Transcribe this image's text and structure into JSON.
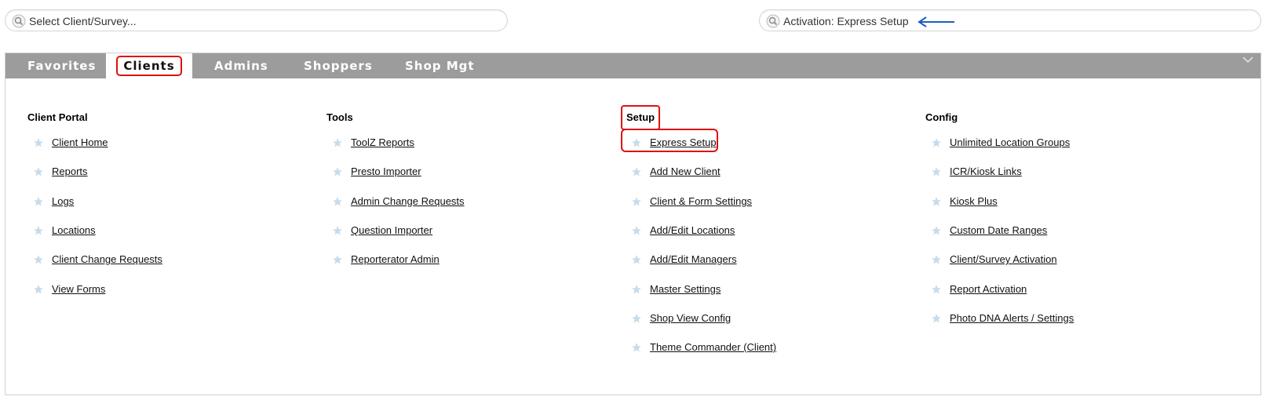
{
  "search_left": {
    "text": "Select Client/Survey..."
  },
  "search_right": {
    "text": "Activation: Express Setup"
  },
  "tabs": [
    {
      "label": "Favorites"
    },
    {
      "label": "Clients"
    },
    {
      "label": "Admins"
    },
    {
      "label": "Shoppers"
    },
    {
      "label": "Shop Mgt"
    }
  ],
  "columns": [
    {
      "heading": "Client Portal",
      "items": [
        "Client Home",
        "Reports",
        "Logs",
        "Locations",
        "Client Change Requests",
        "View Forms"
      ]
    },
    {
      "heading": "Tools",
      "items": [
        "ToolZ Reports",
        "Presto Importer",
        "Admin Change Requests",
        "Question Importer",
        "Reporterator Admin"
      ]
    },
    {
      "heading": "Setup",
      "items": [
        "Express Setup",
        "Add New Client",
        "Client & Form Settings",
        "Add/Edit Locations",
        "Add/Edit Managers",
        "Master Settings",
        "Shop View Config",
        "Theme Commander (Client)"
      ]
    },
    {
      "heading": "Config",
      "items": [
        "Unlimited Location Groups",
        "ICR/Kiosk Links",
        "Kiosk Plus",
        "Custom Date Ranges",
        "Client/Survey Activation",
        "Report Activation",
        "Photo DNA Alerts / Settings"
      ]
    }
  ],
  "colors": {
    "highlight": "#dd1111",
    "tabbar": "#9c9c9c",
    "star": "#c7dcea",
    "arrow": "#1f5fbf"
  },
  "icons": {
    "search": "magnifier-icon",
    "star": "star-icon",
    "collapse": "chevron-down-icon",
    "annotation": "arrow-left-icon"
  }
}
